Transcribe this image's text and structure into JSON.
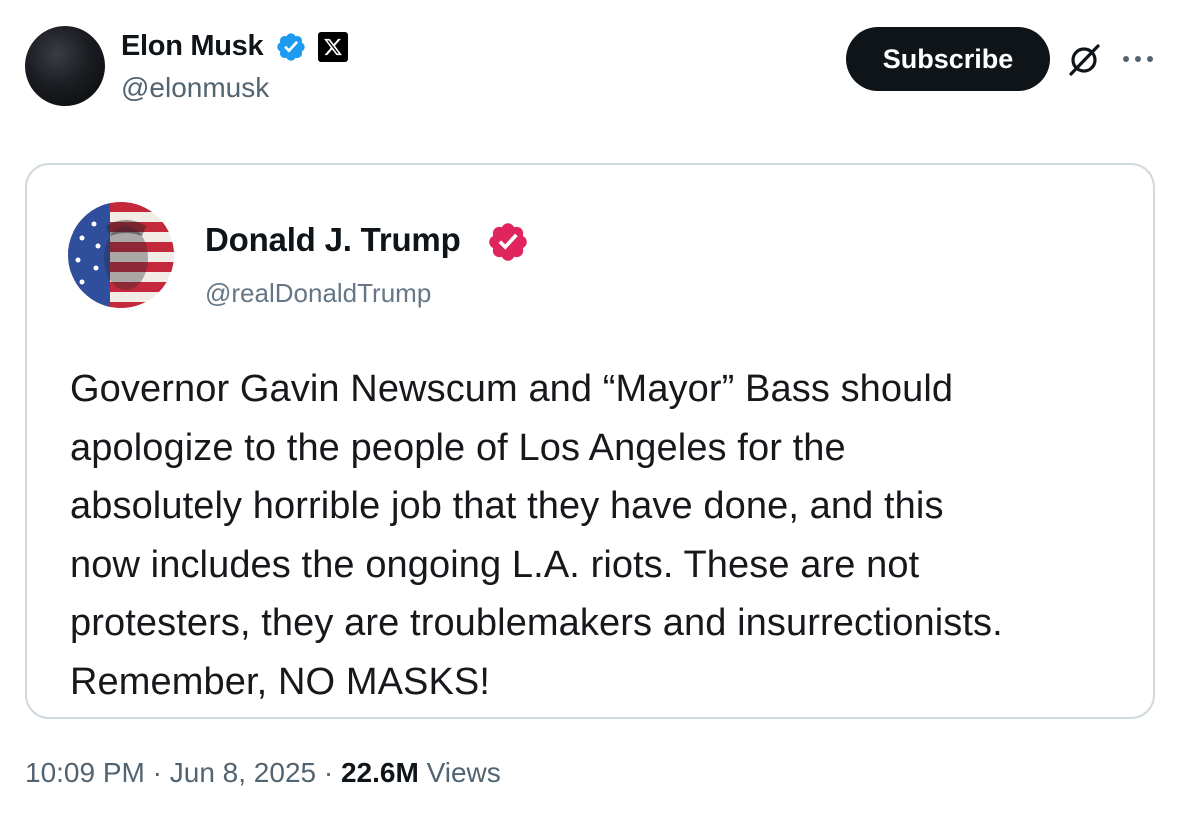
{
  "author": {
    "name": "Elon Musk",
    "handle": "@elonmusk",
    "verified": true,
    "badge_icon": "x-logo-icon"
  },
  "actions": {
    "subscribe_label": "Subscribe",
    "grok_icon": "grok-icon",
    "more_icon": "more-dots-icon"
  },
  "quoted_post": {
    "name": "Donald J. Trump",
    "handle": "@realDonaldTrump",
    "verified_color": "#e0245e",
    "text_lines": [
      "Governor Gavin Newscum and “Mayor” Bass should",
      "apologize to the people of Los Angeles for the",
      "absolutely horrible job that they have done, and this",
      "now includes the ongoing L.A. riots. These are not",
      "protesters, they are troublemakers and insurrectionists.",
      "Remember, NO MASKS!"
    ]
  },
  "meta": {
    "time": "10:09 PM",
    "separator": "·",
    "date": "Jun 8, 2025",
    "views_count": "22.6M",
    "views_label": "Views"
  },
  "colors": {
    "verified_blue": "#1d9bf0",
    "text": "#0f1419",
    "muted": "#536471",
    "border": "#cfd9de"
  }
}
